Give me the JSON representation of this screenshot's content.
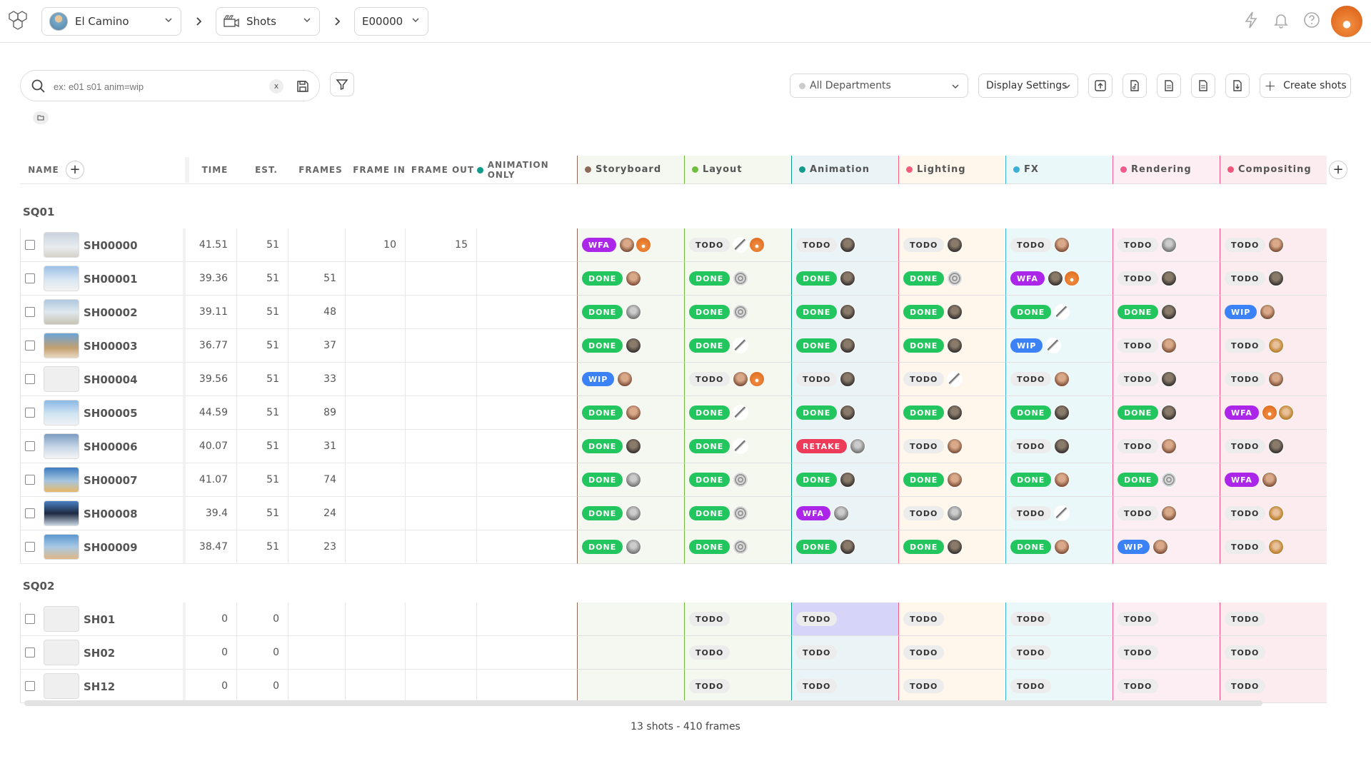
{
  "header": {
    "production": "El Camino",
    "section": "Shots",
    "episode": "E00000"
  },
  "search": {
    "placeholder": "ex: e01 s01 anim=wip",
    "clear": "x"
  },
  "toolbar": {
    "departments": "All Departments",
    "display_settings": "Display Settings",
    "create": "Create shots"
  },
  "columns": {
    "name": "NAME",
    "time": "TIME",
    "est": "EST.",
    "frames": "FRAMES",
    "frame_in": "FRAME IN",
    "frame_out": "FRAME OUT",
    "animation_only": "ANIMATION ONLY"
  },
  "tasks": [
    {
      "name": "Storyboard",
      "color": "#8c6a5a",
      "bg": "#f4f8f0"
    },
    {
      "name": "Layout",
      "color": "#6fbf3c",
      "bg": "#f4f8ee"
    },
    {
      "name": "Animation",
      "color": "#119b8a",
      "bg": "#eaf4f6"
    },
    {
      "name": "Lighting",
      "color": "#f45d7c",
      "bg": "#fff6ec"
    },
    {
      "name": "FX",
      "color": "#3ab0d6",
      "bg": "#eaf8fa"
    },
    {
      "name": "Rendering",
      "color": "#ef5b8c",
      "bg": "#fdeef3"
    },
    {
      "name": "Compositing",
      "color": "#f0567c",
      "bg": "#fdecef"
    }
  ],
  "sequences": [
    {
      "name": "SQ01",
      "shots": [
        {
          "name": "SH00000",
          "time": "41.51",
          "est": "51",
          "frames": "",
          "fin": "10",
          "fout": "15",
          "tasks": [
            [
              "WFA",
              "woman",
              "fox"
            ],
            [
              "TODO",
              "bird",
              "fox"
            ],
            [
              "TODO",
              "dark"
            ],
            [
              "TODO",
              "dark"
            ],
            [
              "TODO",
              "woman"
            ],
            [
              "TODO",
              "grey"
            ],
            [
              "TODO",
              "woman"
            ]
          ]
        },
        {
          "name": "SH00001",
          "time": "39.36",
          "est": "51",
          "frames": "51",
          "fin": "",
          "fout": "",
          "tasks": [
            [
              "DONE",
              "woman"
            ],
            [
              "DONE",
              "globe"
            ],
            [
              "DONE",
              "dark"
            ],
            [
              "DONE",
              "globe"
            ],
            [
              "WFA",
              "dark",
              "fox"
            ],
            [
              "TODO",
              "dark"
            ],
            [
              "TODO",
              "dark"
            ]
          ]
        },
        {
          "name": "SH00002",
          "time": "39.11",
          "est": "51",
          "frames": "48",
          "fin": "",
          "fout": "",
          "tasks": [
            [
              "DONE",
              "grey"
            ],
            [
              "DONE",
              "globe"
            ],
            [
              "DONE",
              "dark"
            ],
            [
              "DONE",
              "dark"
            ],
            [
              "DONE",
              "bird"
            ],
            [
              "DONE",
              "dark"
            ],
            [
              "WIP",
              "woman"
            ]
          ]
        },
        {
          "name": "SH00003",
          "time": "36.77",
          "est": "51",
          "frames": "37",
          "fin": "",
          "fout": "",
          "tasks": [
            [
              "DONE",
              "dark"
            ],
            [
              "DONE",
              "bird"
            ],
            [
              "DONE",
              "dark"
            ],
            [
              "DONE",
              "dark"
            ],
            [
              "WIP",
              "bird"
            ],
            [
              "TODO",
              "woman"
            ],
            [
              "TODO",
              "blonde"
            ]
          ]
        },
        {
          "name": "SH00004",
          "time": "39.56",
          "est": "51",
          "frames": "33",
          "fin": "",
          "fout": "",
          "tasks": [
            [
              "WIP",
              "woman"
            ],
            [
              "TODO",
              "woman",
              "fox"
            ],
            [
              "TODO",
              "dark"
            ],
            [
              "TODO",
              "bird"
            ],
            [
              "TODO",
              "woman"
            ],
            [
              "TODO",
              "dark"
            ],
            [
              "TODO",
              "woman"
            ]
          ]
        },
        {
          "name": "SH00005",
          "time": "44.59",
          "est": "51",
          "frames": "89",
          "fin": "",
          "fout": "",
          "tasks": [
            [
              "DONE",
              "woman"
            ],
            [
              "DONE",
              "bird"
            ],
            [
              "DONE",
              "dark"
            ],
            [
              "DONE",
              "dark"
            ],
            [
              "DONE",
              "dark"
            ],
            [
              "DONE",
              "dark"
            ],
            [
              "WFA",
              "fox",
              "blonde"
            ]
          ]
        },
        {
          "name": "SH00006",
          "time": "40.07",
          "est": "51",
          "frames": "31",
          "fin": "",
          "fout": "",
          "tasks": [
            [
              "DONE",
              "dark"
            ],
            [
              "DONE",
              "bird"
            ],
            [
              "RETAKE",
              "grey"
            ],
            [
              "TODO",
              "woman"
            ],
            [
              "TODO",
              "dark"
            ],
            [
              "TODO",
              "woman"
            ],
            [
              "TODO",
              "dark"
            ]
          ]
        },
        {
          "name": "SH00007",
          "time": "41.07",
          "est": "51",
          "frames": "74",
          "fin": "",
          "fout": "",
          "tasks": [
            [
              "DONE",
              "grey"
            ],
            [
              "DONE",
              "globe"
            ],
            [
              "DONE",
              "dark"
            ],
            [
              "DONE",
              "woman"
            ],
            [
              "DONE",
              "woman"
            ],
            [
              "DONE",
              "globe"
            ],
            [
              "WFA",
              "woman"
            ]
          ]
        },
        {
          "name": "SH00008",
          "time": "39.4",
          "est": "51",
          "frames": "24",
          "fin": "",
          "fout": "",
          "tasks": [
            [
              "DONE",
              "grey"
            ],
            [
              "DONE",
              "globe"
            ],
            [
              "WFA",
              "grey"
            ],
            [
              "TODO",
              "grey"
            ],
            [
              "TODO",
              "bird"
            ],
            [
              "TODO",
              "woman"
            ],
            [
              "TODO",
              "blonde"
            ]
          ]
        },
        {
          "name": "SH00009",
          "time": "38.47",
          "est": "51",
          "frames": "23",
          "fin": "",
          "fout": "",
          "tasks": [
            [
              "DONE",
              "grey"
            ],
            [
              "DONE",
              "globe"
            ],
            [
              "DONE",
              "dark"
            ],
            [
              "DONE",
              "dark"
            ],
            [
              "DONE",
              "woman"
            ],
            [
              "WIP",
              "woman"
            ],
            [
              "TODO",
              "blonde"
            ]
          ]
        }
      ]
    },
    {
      "name": "SQ02",
      "shots": [
        {
          "name": "SH01",
          "time": "0",
          "est": "0",
          "frames": "",
          "fin": "",
          "fout": "",
          "tasks": [
            [],
            [
              "TODO"
            ],
            [
              "TODO"
            ],
            [
              "TODO"
            ],
            [
              "TODO"
            ],
            [
              "TODO"
            ],
            [
              "TODO"
            ]
          ]
        },
        {
          "name": "SH02",
          "time": "0",
          "est": "0",
          "frames": "",
          "fin": "",
          "fout": "",
          "tasks": [
            [],
            [
              "TODO"
            ],
            [
              "TODO"
            ],
            [
              "TODO"
            ],
            [
              "TODO"
            ],
            [
              "TODO"
            ],
            [
              "TODO"
            ]
          ]
        },
        {
          "name": "SH12",
          "time": "0",
          "est": "0",
          "frames": "",
          "fin": "",
          "fout": "",
          "tasks": [
            [],
            [
              "TODO"
            ],
            [
              "TODO"
            ],
            [
              "TODO"
            ],
            [
              "TODO"
            ],
            [
              "TODO"
            ],
            [
              "TODO"
            ]
          ]
        }
      ]
    }
  ],
  "footer": "13 shots - 410 frames",
  "icons": [
    "kitsu-logo-icon",
    "chevron-down-icon",
    "chevron-right-icon",
    "shots-icon",
    "lightning-icon",
    "bell-icon",
    "help-icon",
    "search-icon",
    "save-icon",
    "filter-icon",
    "import-icon",
    "export-icon",
    "folder-icon"
  ]
}
